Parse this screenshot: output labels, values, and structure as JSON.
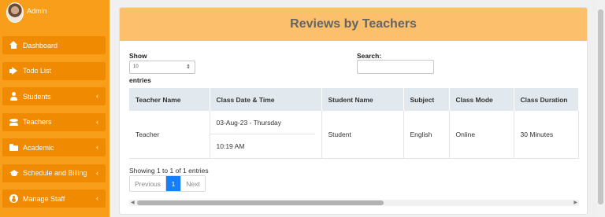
{
  "sidebar": {
    "user_name": "Admin",
    "items": [
      {
        "label": "Dashboard",
        "icon": "home-icon",
        "has_submenu": false
      },
      {
        "label": "Todo List",
        "icon": "megaphone-icon",
        "has_submenu": false
      },
      {
        "label": "Students",
        "icon": "user-icon",
        "has_submenu": true
      },
      {
        "label": "Teachers",
        "icon": "users-icon",
        "has_submenu": true
      },
      {
        "label": "Academic",
        "icon": "folder-icon",
        "has_submenu": true
      },
      {
        "label": "Schedule and Billing",
        "icon": "graduation-cap-icon",
        "has_submenu": true
      },
      {
        "label": "Manage Staff",
        "icon": "user-circle-icon",
        "has_submenu": true
      }
    ],
    "chevron": "‹",
    "bg_color": "#f99e1b",
    "item_color": "#f08a00"
  },
  "card": {
    "title": "Reviews by Teachers",
    "header_color": "#fcbf6b"
  },
  "controls": {
    "show_label": "Show",
    "show_value": "10",
    "entries_label": "entries",
    "search_label": "Search:",
    "search_value": ""
  },
  "table": {
    "headers": [
      "Teacher Name",
      "Class Date & Time",
      "Student Name",
      "Subject",
      "Class Mode",
      "Class Duration"
    ],
    "rows": [
      {
        "teacher_name": "Teacher",
        "class_date": "03-Aug-23 - Thursday",
        "class_time": "10:19 AM",
        "student_name": "Student",
        "subject": "English",
        "class_mode": "Online",
        "class_duration": "30 Minutes"
      }
    ]
  },
  "footer": {
    "showing_text": "Showing 1 to 1 of 1 entries",
    "prev_label": "Previous",
    "current_page": "1",
    "next_label": "Next",
    "active_color": "#157efb"
  }
}
